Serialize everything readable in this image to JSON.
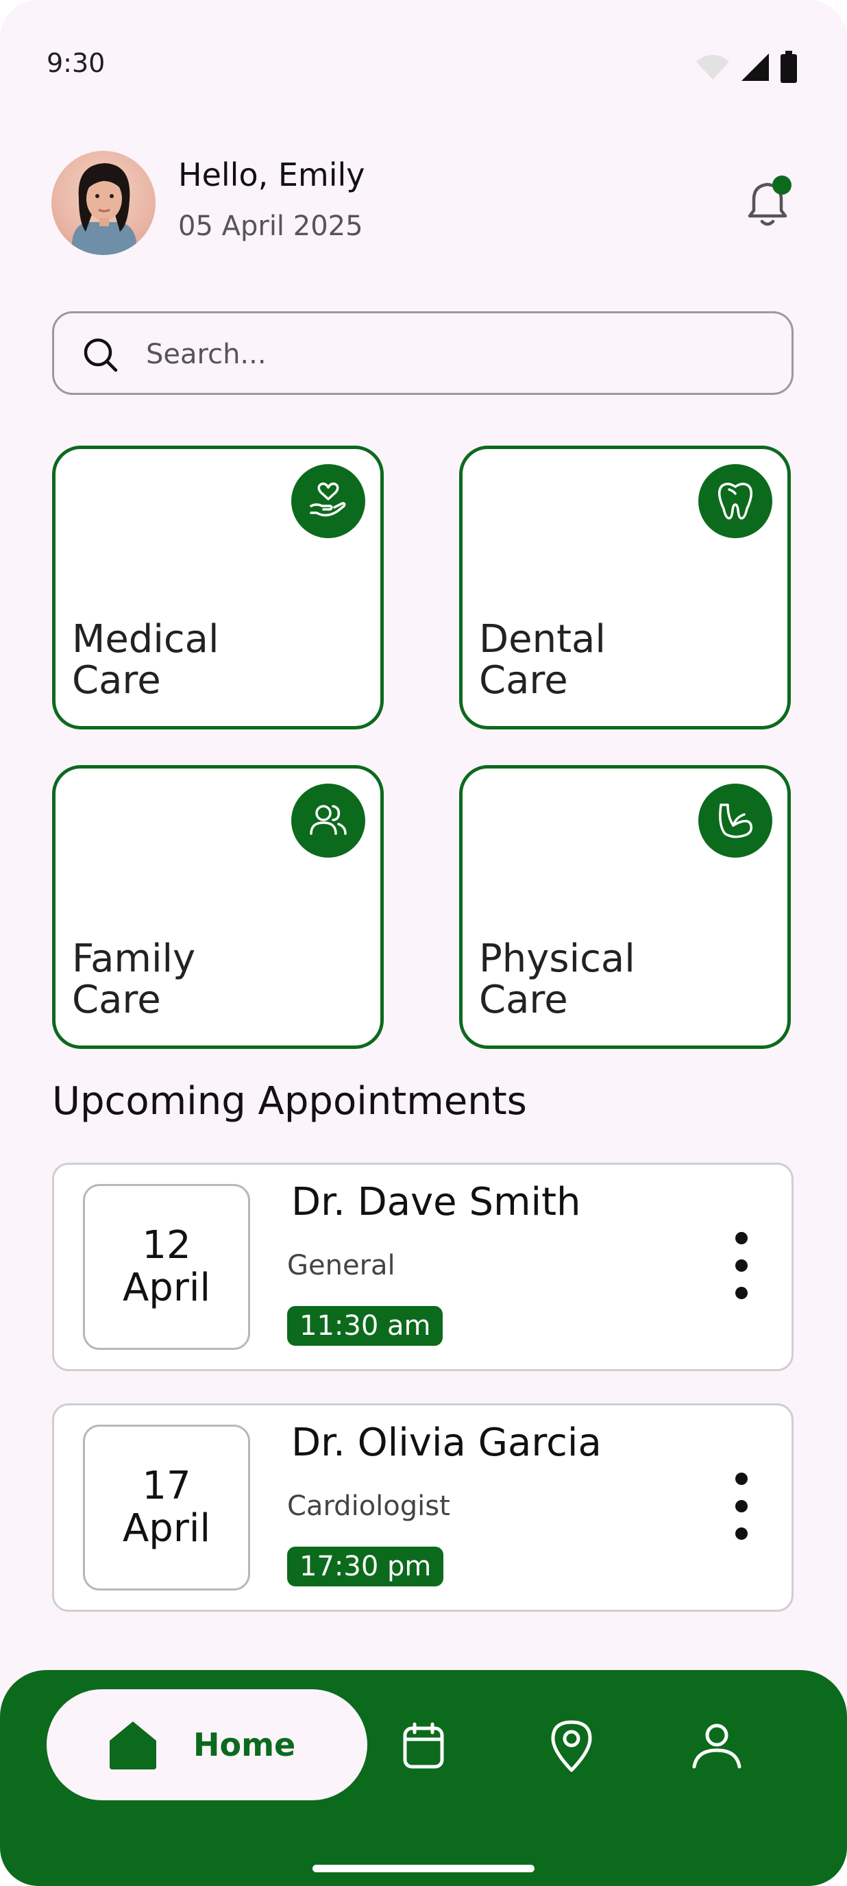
{
  "status_bar": {
    "time": "9:30"
  },
  "header": {
    "greeting": "Hello, Emily",
    "date": "05 April 2025"
  },
  "search": {
    "placeholder": "Search..."
  },
  "categories": [
    {
      "label": "Medical\nCare",
      "icon": "hand-heart-icon"
    },
    {
      "label": "Dental\nCare",
      "icon": "tooth-icon"
    },
    {
      "label": "Family\nCare",
      "icon": "people-icon"
    },
    {
      "label": "Physical\nCare",
      "icon": "flexed-arm-icon"
    }
  ],
  "appointments_section": {
    "title": "Upcoming Appointments"
  },
  "appointments": [
    {
      "day": "12",
      "month": "April",
      "doctor": "Dr. Dave Smith",
      "specialty": "General",
      "time": "11:30 am"
    },
    {
      "day": "17",
      "month": "April",
      "doctor": "Dr. Olivia Garcia",
      "specialty": "Cardiologist",
      "time": "17:30 pm"
    }
  ],
  "nav": {
    "home_label": "Home",
    "items": [
      "home-icon",
      "calendar-icon",
      "location-pin-icon",
      "profile-icon"
    ]
  },
  "colors": {
    "accent": "#0C6A1D",
    "background": "#FBF4FB"
  }
}
